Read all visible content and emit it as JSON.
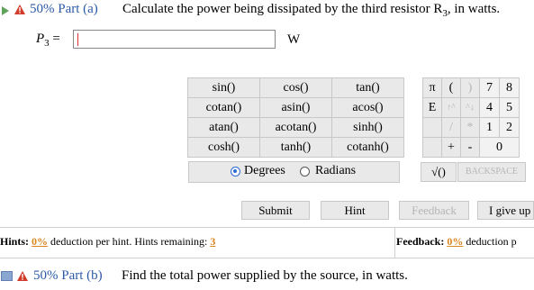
{
  "part_a": {
    "percent": "50% Part (a)",
    "question": "Calculate the power being dissipated by the third resistor R",
    "subscript": "3",
    "question_suffix": ", in watts.",
    "answer_label": "P",
    "answer_label_sub": "3",
    "answer_eq": "=",
    "answer_value": "",
    "unit": "W"
  },
  "calculator": {
    "functions": [
      [
        "sin()",
        "cos()",
        "tan()"
      ],
      [
        "cotan()",
        "asin()",
        "acos()"
      ],
      [
        "atan()",
        "acotan()",
        "sinh()"
      ],
      [
        "cosh()",
        "tanh()",
        "cotanh()"
      ]
    ],
    "symbols": [
      [
        "π",
        "(",
        ")",
        "7",
        "8"
      ],
      [
        "E",
        "↑^",
        "^↓",
        "4",
        "5"
      ],
      [
        "",
        "/",
        "*",
        "1",
        "2"
      ],
      [
        "",
        "+",
        "-",
        "0",
        ""
      ]
    ],
    "degrees_label": "Degrees",
    "radians_label": "Radians",
    "angle_mode": "Degrees",
    "sqrt_label": "√()",
    "backspace_label": "BACKSPACE"
  },
  "actions": {
    "submit": "Submit",
    "hint": "Hint",
    "feedback": "Feedback",
    "give_up": "I give up"
  },
  "hints_bar": {
    "hints_label": "Hints:",
    "hints_pct": "0%",
    "hints_text": "deduction per hint. Hints remaining:",
    "hints_remaining": "3",
    "feedback_label": "Feedback:",
    "feedback_pct": "0%",
    "feedback_text": "deduction p"
  },
  "part_b": {
    "percent": "50% Part (b)",
    "question": "Find the total power supplied by the source, in watts."
  },
  "colors": {
    "accent": "#2d5aa8",
    "warning": "#d9861d",
    "play": "#5fa35a"
  }
}
